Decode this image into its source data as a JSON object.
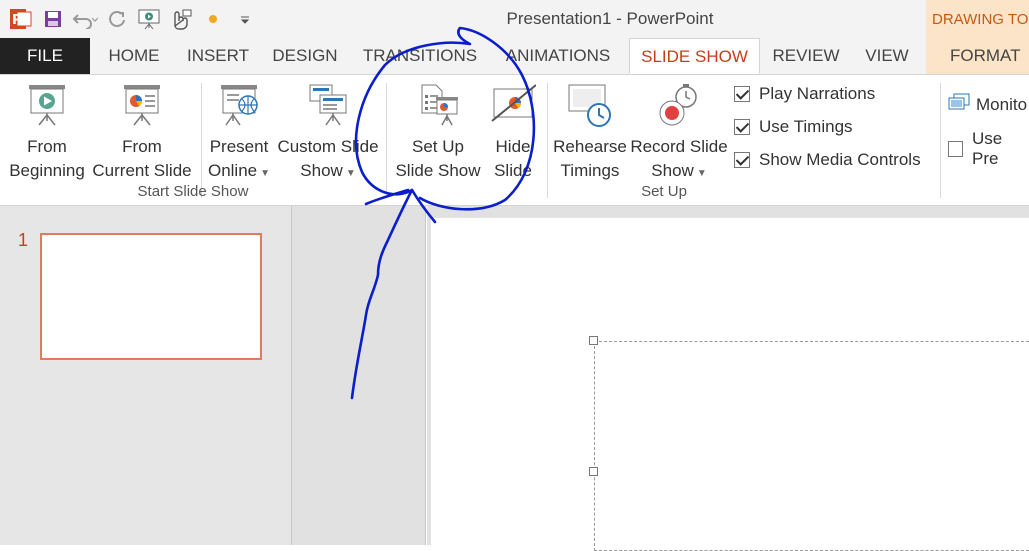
{
  "window": {
    "title": "Presentation1 - PowerPoint",
    "contextual_tab_group": "DRAWING TOOLS"
  },
  "tabs": [
    {
      "label": "FILE"
    },
    {
      "label": "HOME"
    },
    {
      "label": "INSERT"
    },
    {
      "label": "DESIGN"
    },
    {
      "label": "TRANSITIONS"
    },
    {
      "label": "ANIMATIONS"
    },
    {
      "label": "SLIDE SHOW"
    },
    {
      "label": "REVIEW"
    },
    {
      "label": "VIEW"
    },
    {
      "label": "FORMAT"
    }
  ],
  "ribbon": {
    "start_group": {
      "label": "Start Slide Show",
      "from_beginning": {
        "line1": "From",
        "line2": "Beginning"
      },
      "from_current": {
        "line1": "From",
        "line2": "Current Slide"
      },
      "present_online": {
        "line1": "Present",
        "line2": "Online"
      },
      "custom_show": {
        "line1": "Custom Slide",
        "line2": "Show"
      }
    },
    "setup_group": {
      "label": "Set Up",
      "setup_show": {
        "line1": "Set Up",
        "line2": "Slide Show"
      },
      "hide_slide": {
        "line1": "Hide",
        "line2": "Slide"
      },
      "rehearse": {
        "line1": "Rehearse",
        "line2": "Timings"
      },
      "record": {
        "line1": "Record Slide",
        "line2": "Show"
      },
      "checks": [
        {
          "label": "Play Narrations",
          "checked": true
        },
        {
          "label": "Use Timings",
          "checked": true
        },
        {
          "label": "Show Media Controls",
          "checked": true
        }
      ]
    },
    "monitors_group": {
      "monitor_label": "Monito",
      "presenter_label": "Use Pre",
      "presenter_checked": false
    }
  },
  "slides": {
    "number": "1"
  },
  "colors": {
    "accent": "#c43e1c",
    "pen": "#0a1ecc",
    "file_tab": "#222222",
    "contextual": "#fce4c8"
  }
}
